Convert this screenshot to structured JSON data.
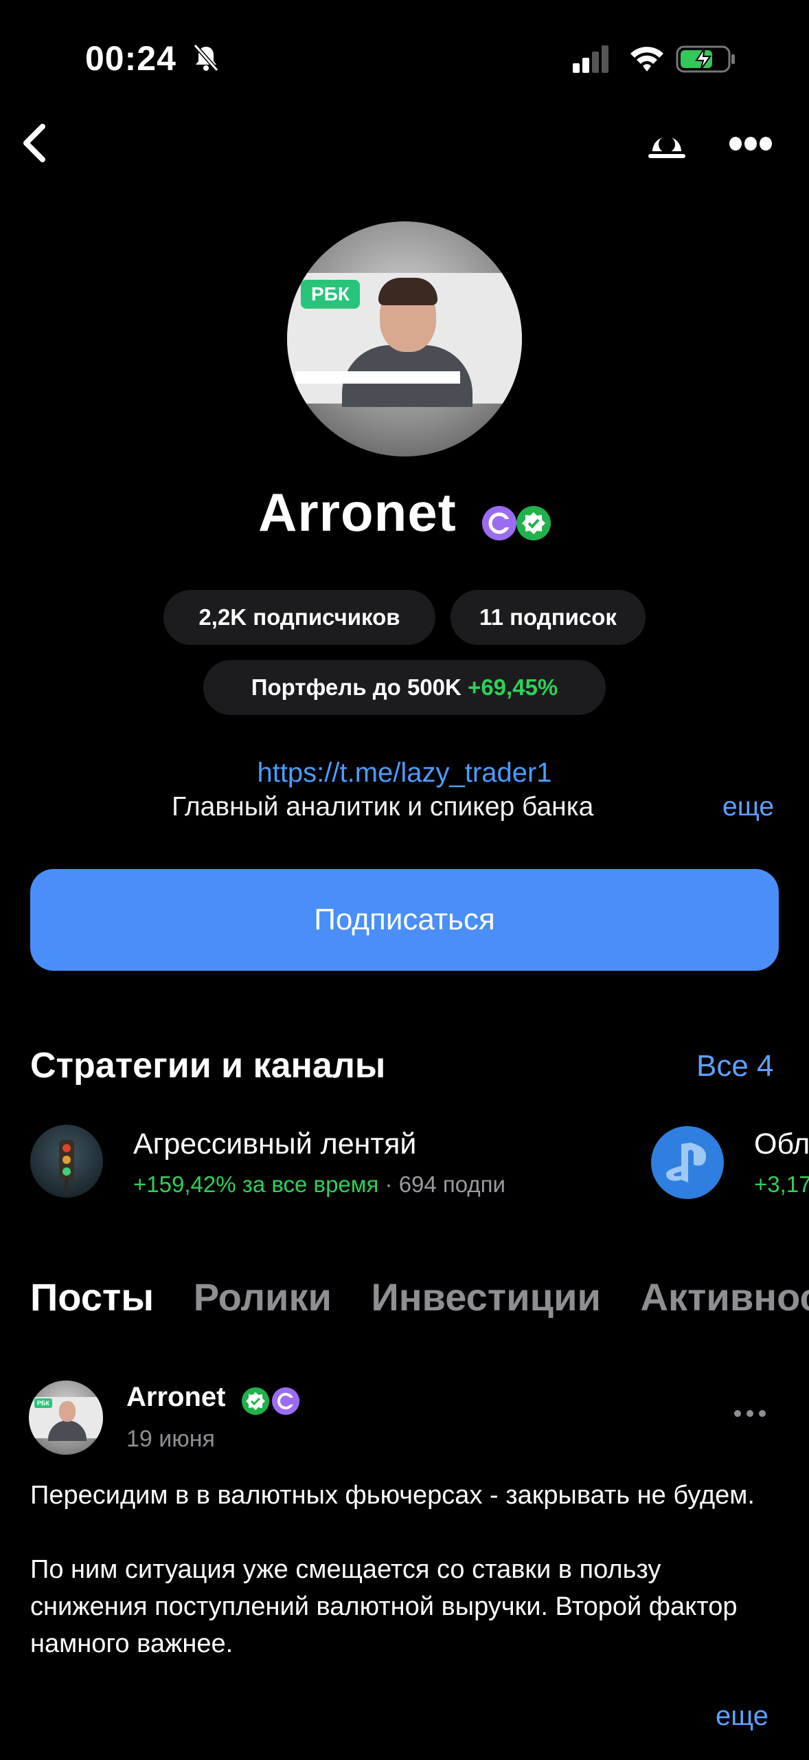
{
  "status_bar": {
    "time": "00:24"
  },
  "profile": {
    "name": "Arronet",
    "avatar_badge_text": "РБК",
    "stats": {
      "followers": "2,2K подписчиков",
      "following": "11 подписок"
    },
    "portfolio": {
      "label": "Портфель до 500K",
      "change": "+69,45%"
    },
    "link": "https://t.me/lazy_trader1",
    "bio": "Главный аналитик и спикер банка",
    "bio_more": "еще",
    "subscribe_label": "Подписаться"
  },
  "strategies": {
    "title": "Стратегии и каналы",
    "all_label": "Все 4",
    "items": [
      {
        "name": "Агрессивный лентяй",
        "return": "+159,42% за все время",
        "separator": "·",
        "subscribers": "694 подпи"
      },
      {
        "name": "Обл",
        "return": "+3,17"
      }
    ]
  },
  "tabs": [
    "Посты",
    "Ролики",
    "Инвестиции",
    "Активнос"
  ],
  "post": {
    "author": "Arronet",
    "avatar_badge_text": "РБК",
    "date": "19 июня",
    "paragraphs": [
      "Пересидим в в валютных фьючерсах - закрывать не будем.",
      "По ним ситуация уже смещается со ставки в пользу снижения поступлений валютной выручки. Второй фактор намного важнее."
    ],
    "more_label": "еще"
  },
  "colors": {
    "accent": "#4a8ff7",
    "link": "#5ea1ff",
    "positive": "#2fd158",
    "pill_bg": "#1c1c1e"
  }
}
